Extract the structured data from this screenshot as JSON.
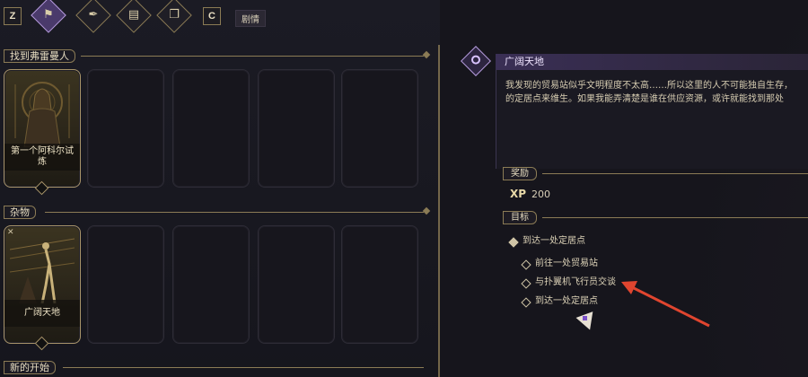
{
  "toolbar": {
    "key_left": "Z",
    "key_right": "C",
    "tab_label": "剧情",
    "tools": [
      "banner-icon",
      "quill-icon",
      "journal-icon",
      "cards-icon"
    ]
  },
  "sections": {
    "find_frey": "找到弗雷曼人",
    "misc": "杂物",
    "new_start": "新的开始"
  },
  "cards": {
    "row1": [
      {
        "title": "第一个阿科尔试炼"
      }
    ],
    "row2": [
      {
        "title": "广阔天地"
      }
    ]
  },
  "quest": {
    "title": "广阔天地",
    "description": "我发现的贸易站似乎文明程度不太高……所以这里的人不可能独自生存，\n的定居点来维生。如果我能弄清楚是谁在供应资源，或许就能找到那处",
    "reward_label": "奖励",
    "xp_label": "XP",
    "xp_value": "200",
    "objective_label": "目标",
    "objectives": [
      {
        "text": "到达一处定居点",
        "level": 0
      },
      {
        "text": "前往一处贸易站",
        "level": 1
      },
      {
        "text": "与扑翼机飞行员交谈",
        "level": 1
      },
      {
        "text": "到达一处定居点",
        "level": 1
      }
    ]
  },
  "colors": {
    "accent_gold": "#8b7b55",
    "accent_purple": "#b59bdc",
    "arrow_red": "#e0452f"
  }
}
